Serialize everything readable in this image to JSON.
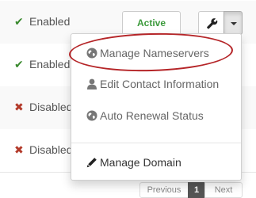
{
  "rows": [
    {
      "status": "Enabled",
      "status_icon": "check-icon"
    },
    {
      "status": "Enabled",
      "status_icon": "check-icon"
    },
    {
      "status": "Disabled",
      "status_icon": "cross-icon"
    },
    {
      "status": "Disabled",
      "status_icon": "cross-icon"
    }
  ],
  "active_label": "Active",
  "dropdown": {
    "items": [
      {
        "label": "Manage Nameservers",
        "icon": "globe-icon"
      },
      {
        "label": "Edit Contact Information",
        "icon": "user-icon"
      },
      {
        "label": "Auto Renewal Status",
        "icon": "globe-icon"
      },
      {
        "label": "Manage Domain",
        "icon": "pencil-icon"
      }
    ]
  },
  "pagination": {
    "previous": "Previous",
    "current": "1",
    "next": "Next"
  },
  "colors": {
    "enabled": "#3a8a2e",
    "disabled": "#b33a2a",
    "active_text": "#3c9a3c",
    "highlight_ring": "#b52528"
  }
}
